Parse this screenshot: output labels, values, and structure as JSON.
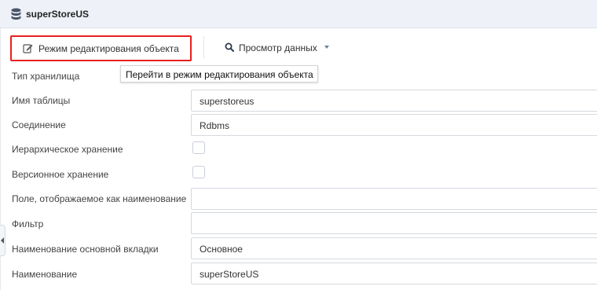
{
  "header": {
    "title": "superStoreUS",
    "icon": "database-icon"
  },
  "toolbar": {
    "edit_mode_label": "Режим редактирования объекта",
    "edit_mode_icon": "pencil-edit-icon",
    "view_data_label": "Просмотр данных",
    "view_data_icon": "search-icon",
    "highlight_color": "#e8201e"
  },
  "tooltip": {
    "text": "Перейти в режим редактирования объекта"
  },
  "form": {
    "storage_type": {
      "label": "Тип хранилища",
      "value": ""
    },
    "table_name": {
      "label": "Имя таблицы",
      "value": "superstoreus"
    },
    "connection": {
      "label": "Соединение",
      "value": "Rdbms"
    },
    "hierarchical": {
      "label": "Иерархическое хранение",
      "checked": false
    },
    "versioned": {
      "label": "Версионное хранение",
      "checked": false
    },
    "display_field": {
      "label": "Поле, отображаемое как наименование",
      "value": ""
    },
    "filter": {
      "label": "Фильтр",
      "value": ""
    },
    "main_tab_name": {
      "label": "Наименование основной вкладки",
      "value": "Основное"
    },
    "name": {
      "label": "Наименование",
      "value": "superStoreUS"
    }
  }
}
